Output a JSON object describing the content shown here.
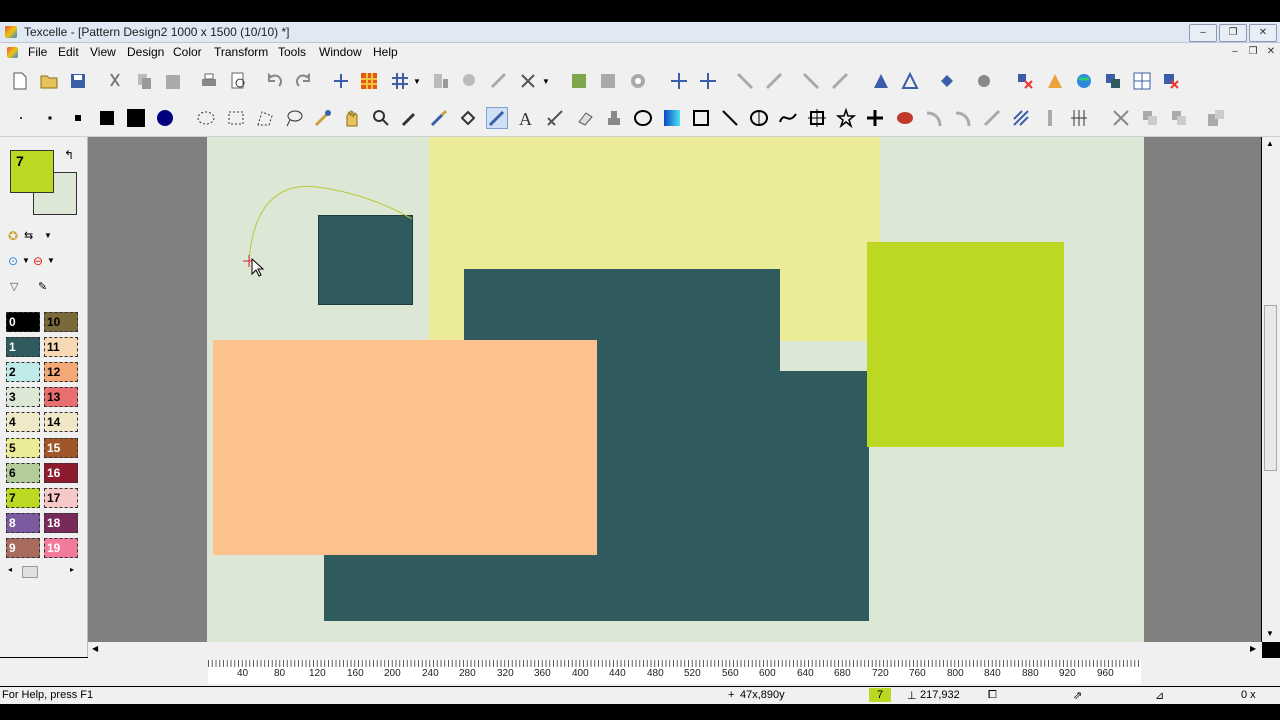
{
  "window": {
    "title": "Texcelle - [Pattern Design2 1000 x 1500 (10/10) *]"
  },
  "menu": [
    "File",
    "Edit",
    "View",
    "Design",
    "Color",
    "Transform",
    "Tools",
    "Window",
    "Help"
  ],
  "palette": {
    "current_index": "7",
    "current_color": "#bcd822",
    "background_color": "#dde7d5",
    "swatches": [
      {
        "n": "0",
        "color": "#000000"
      },
      {
        "n": "10",
        "color": "#7a6a3a"
      },
      {
        "n": "1",
        "color": "#2f5a5e"
      },
      {
        "n": "11",
        "color": "#f7d9b3"
      },
      {
        "n": "2",
        "color": "#bfeaea"
      },
      {
        "n": "12",
        "color": "#f5a878"
      },
      {
        "n": "3",
        "color": "#dde7d5"
      },
      {
        "n": "13",
        "color": "#e86f6f"
      },
      {
        "n": "4",
        "color": "#efe9c8"
      },
      {
        "n": "14",
        "color": "#f0e7c8"
      },
      {
        "n": "5",
        "color": "#ecec98"
      },
      {
        "n": "15",
        "color": "#a0562b"
      },
      {
        "n": "6",
        "color": "#b3cd9a"
      },
      {
        "n": "16",
        "color": "#8e1a2e"
      },
      {
        "n": "7",
        "color": "#bcd822"
      },
      {
        "n": "17",
        "color": "#f7c8c8"
      },
      {
        "n": "8",
        "color": "#7b5aa0"
      },
      {
        "n": "18",
        "color": "#7a2a5a"
      },
      {
        "n": "9",
        "color": "#a96a5f"
      },
      {
        "n": "19",
        "color": "#f27a9a"
      }
    ]
  },
  "design_colors": {
    "canvas": "#dde7d5",
    "dark_teal": "#2f5a5e",
    "pale_yellow": "#ecec98",
    "peach": "#fdc18e",
    "lime": "#bcd822"
  },
  "ruler": {
    "ticks": [
      "40",
      "80",
      "120",
      "160",
      "200",
      "240",
      "280",
      "320",
      "360",
      "400",
      "440",
      "480",
      "520",
      "560",
      "600",
      "640",
      "680",
      "720",
      "760",
      "800",
      "840",
      "880",
      "920",
      "960"
    ]
  },
  "status": {
    "help": "For Help, press F1",
    "cursor_pos": "47x,890y",
    "color_index": "7",
    "size": "217,932",
    "zoom": "0 x"
  }
}
